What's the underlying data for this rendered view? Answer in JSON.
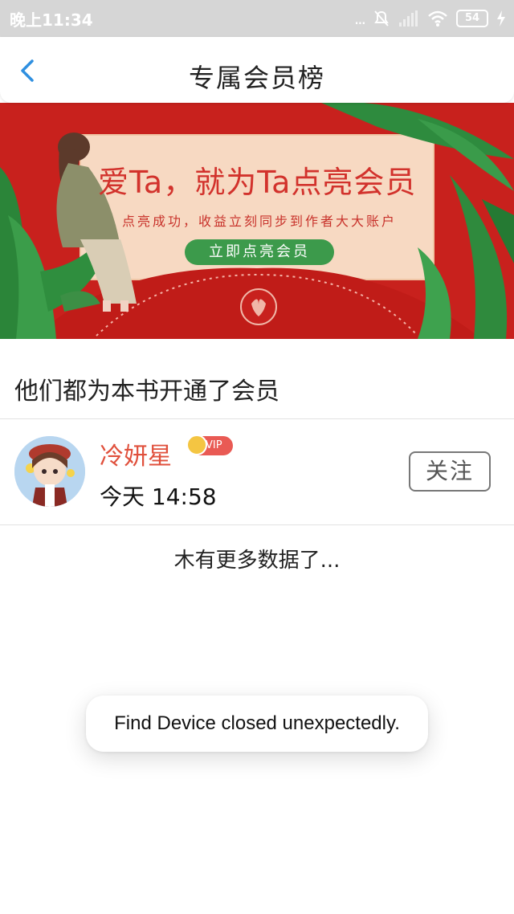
{
  "status_bar": {
    "time": "晚上11:34",
    "battery": "54",
    "dots": "..."
  },
  "header": {
    "title": "专属会员榜"
  },
  "banner": {
    "headline": "爱Ta，就为Ta点亮会员",
    "subtitle": "点亮成功，收益立刻同步到作者大大账户",
    "button_label": "立即点亮会员"
  },
  "section": {
    "title": "他们都为本书开通了会员"
  },
  "members": [
    {
      "name": "冷妍星",
      "badge": "VIP",
      "time": "今天 14:58",
      "follow_label": "关注"
    }
  ],
  "list_end_text": "木有更多数据了...",
  "toast": {
    "message": "Find Device closed unexpectedly."
  },
  "colors": {
    "accent_blue": "#2f8fe0",
    "banner_red": "#c8211d",
    "name_red": "#e0503c",
    "button_green": "#3c9a4b"
  }
}
